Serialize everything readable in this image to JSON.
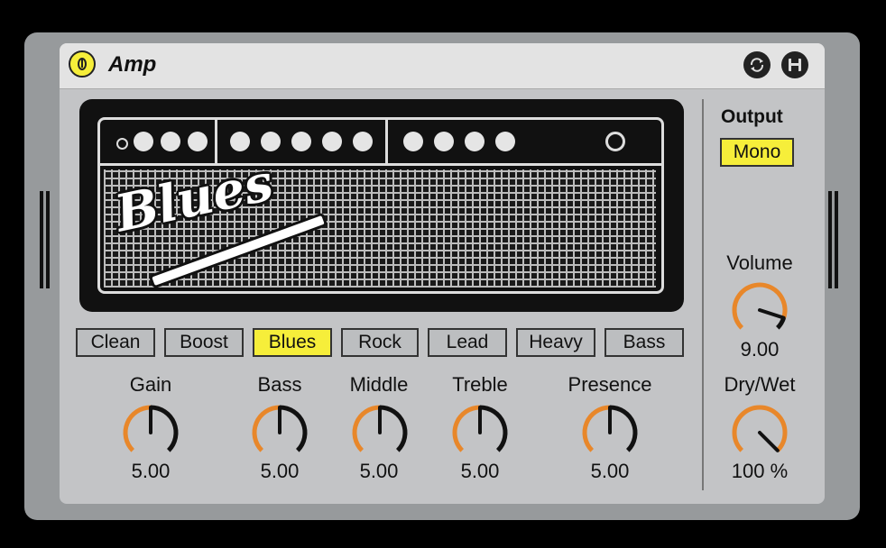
{
  "device": {
    "title": "Amp",
    "icons": [
      "power-icon",
      "hot-swap-icon",
      "save-icon"
    ]
  },
  "colors": {
    "accent": "#f6ee3a",
    "knob_arc": "#e8872a",
    "background": "#c3c4c6"
  },
  "amp_face": {
    "logo": "Blues"
  },
  "presets": [
    {
      "label": "Clean",
      "active": false
    },
    {
      "label": "Boost",
      "active": false
    },
    {
      "label": "Blues",
      "active": true
    },
    {
      "label": "Rock",
      "active": false
    },
    {
      "label": "Lead",
      "active": false
    },
    {
      "label": "Heavy",
      "active": false
    },
    {
      "label": "Bass",
      "active": false
    }
  ],
  "knobs": [
    {
      "label": "Gain",
      "value": "5.00",
      "level": 0.5
    },
    {
      "label": "Bass",
      "value": "5.00",
      "level": 0.5
    },
    {
      "label": "Middle",
      "value": "5.00",
      "level": 0.5
    },
    {
      "label": "Treble",
      "value": "5.00",
      "level": 0.5
    },
    {
      "label": "Presence",
      "value": "5.00",
      "level": 0.5
    }
  ],
  "output": {
    "label": "Output",
    "mode": "Mono"
  },
  "volume": {
    "label": "Volume",
    "value": "9.00",
    "level": 0.9
  },
  "drywet": {
    "label": "Dry/Wet",
    "value": "100 %",
    "level": 1.0
  }
}
